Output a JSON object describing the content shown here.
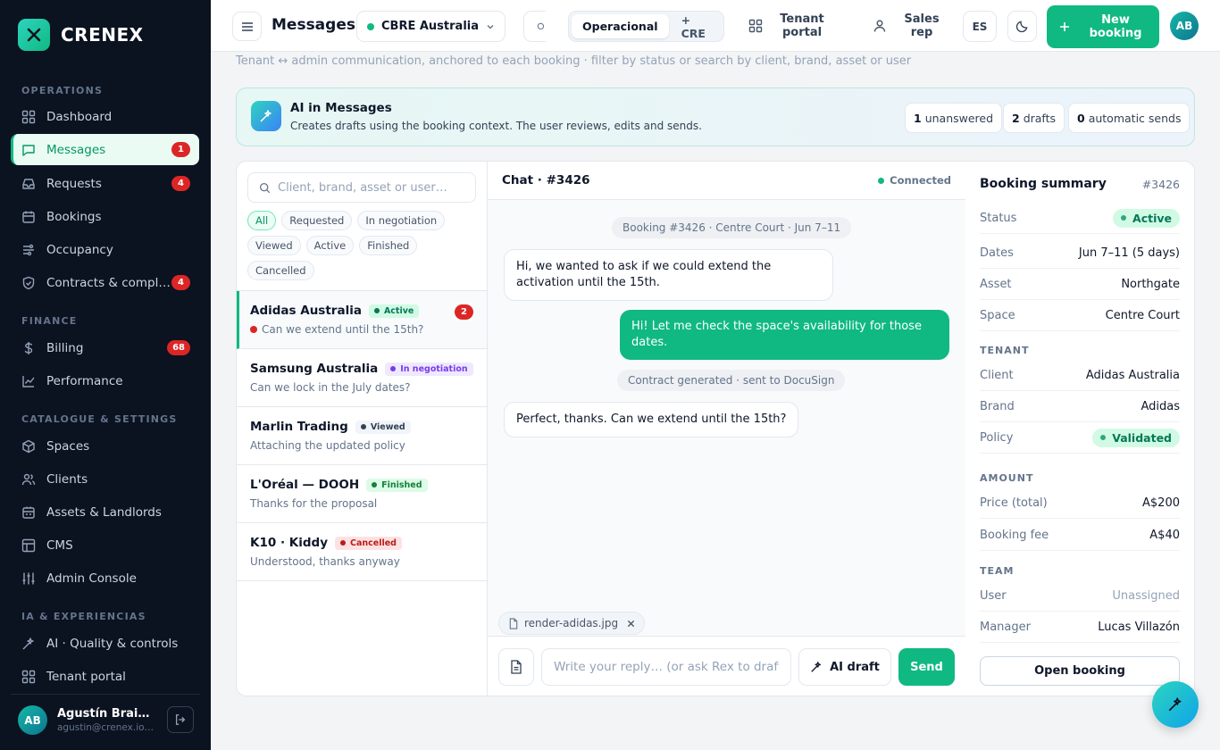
{
  "brand": {
    "name": "CRENEX"
  },
  "sidebar": {
    "sections": [
      "OPERATIONS",
      "FINANCE",
      "CATALOGUE & SETTINGS",
      "IA & EXPERIENCIAS"
    ],
    "items": [
      {
        "label": "Dashboard"
      },
      {
        "label": "Messages",
        "badge": "1"
      },
      {
        "label": "Requests",
        "badge": "4"
      },
      {
        "label": "Bookings"
      },
      {
        "label": "Occupancy"
      },
      {
        "label": "Contracts & compl…",
        "badge": "4"
      },
      {
        "label": "Billing",
        "badge": "68"
      },
      {
        "label": "Performance"
      },
      {
        "label": "Spaces"
      },
      {
        "label": "Clients"
      },
      {
        "label": "Assets & Landlords"
      },
      {
        "label": "CMS"
      },
      {
        "label": "Admin Console"
      },
      {
        "label": "AI · Quality & controls"
      },
      {
        "label": "Tenant portal"
      }
    ],
    "user": {
      "initials": "AB",
      "name": "Agustín Braid…",
      "email": "agustin@crenex.io…"
    }
  },
  "topbar": {
    "title": "Messages",
    "org": "CBRE Australia",
    "segments": [
      "Operacional",
      "+ CRE"
    ],
    "tenant_portal": "Tenant portal",
    "sales_rep": "Sales rep",
    "lang": "ES",
    "new_booking": "New booking",
    "avatar": "AB"
  },
  "subtitle": "Tenant ↔ admin communication, anchored to each booking · filter by status or search by client, brand, asset or user",
  "ai_banner": {
    "title": "AI in Messages",
    "desc": "Creates drafts using the booking context. The user reviews, edits and sends.",
    "stats": [
      {
        "num": "1",
        "label": "unanswered"
      },
      {
        "num": "2",
        "label": "drafts"
      },
      {
        "num": "0",
        "label": "automatic sends"
      }
    ]
  },
  "list": {
    "search_placeholder": "Client, brand, asset or user…",
    "filters": [
      "All",
      "Requested",
      "In negotiation",
      "Viewed",
      "Active",
      "Finished",
      "Cancelled"
    ],
    "conversations": [
      {
        "name": "Adidas Australia",
        "status": "Active",
        "preview": "Can we extend until the 15th?",
        "badge": "2"
      },
      {
        "name": "Samsung Australia",
        "status": "In negotiation",
        "preview": "Can we lock in the July dates?"
      },
      {
        "name": "Marlin Trading",
        "status": "Viewed",
        "preview": "Attaching the updated policy"
      },
      {
        "name": "L'Oréal — DOOH",
        "status": "Finished",
        "preview": "Thanks for the proposal"
      },
      {
        "name": "K10 · Kiddy",
        "status": "Cancelled",
        "preview": "Understood, thanks anyway"
      }
    ]
  },
  "chat": {
    "title": "Chat · #3426",
    "connection": "Connected",
    "messages": [
      {
        "type": "system",
        "text": "Booking #3426 · Centre Court · Jun 7–11"
      },
      {
        "type": "in",
        "text": "Hi, we wanted to ask if we could extend the activation until the 15th."
      },
      {
        "type": "out",
        "text": "Hi! Let me check the space's availability for those dates."
      },
      {
        "type": "system",
        "text": "Contract generated · sent to DocuSign"
      },
      {
        "type": "in",
        "text": "Perfect, thanks. Can we extend until the 15th?"
      }
    ],
    "attachment": "render-adidas.jpg",
    "reply_placeholder": "Write your reply… (or ask Rex to draft)",
    "ai_draft": "AI draft",
    "send": "Send"
  },
  "summary": {
    "title": "Booking summary",
    "id": "#3426",
    "rows_main": [
      {
        "k": "Status",
        "v": "Active"
      },
      {
        "k": "Dates",
        "v": "Jun 7–11 (5 days)"
      },
      {
        "k": "Asset",
        "v": "Northgate"
      },
      {
        "k": "Space",
        "v": "Centre Court"
      }
    ],
    "tenant_label": "TENANT",
    "rows_tenant": [
      {
        "k": "Client",
        "v": "Adidas Australia"
      },
      {
        "k": "Brand",
        "v": "Adidas"
      },
      {
        "k": "Policy",
        "v": "Validated"
      }
    ],
    "amount_label": "AMOUNT",
    "rows_amount": [
      {
        "k": "Price (total)",
        "v": "A$200"
      },
      {
        "k": "Booking fee",
        "v": "A$40"
      }
    ],
    "team_label": "TEAM",
    "rows_team": [
      {
        "k": "User",
        "v": "Unassigned"
      },
      {
        "k": "Manager",
        "v": "Lucas Villazón"
      }
    ],
    "open_booking": "Open booking"
  }
}
